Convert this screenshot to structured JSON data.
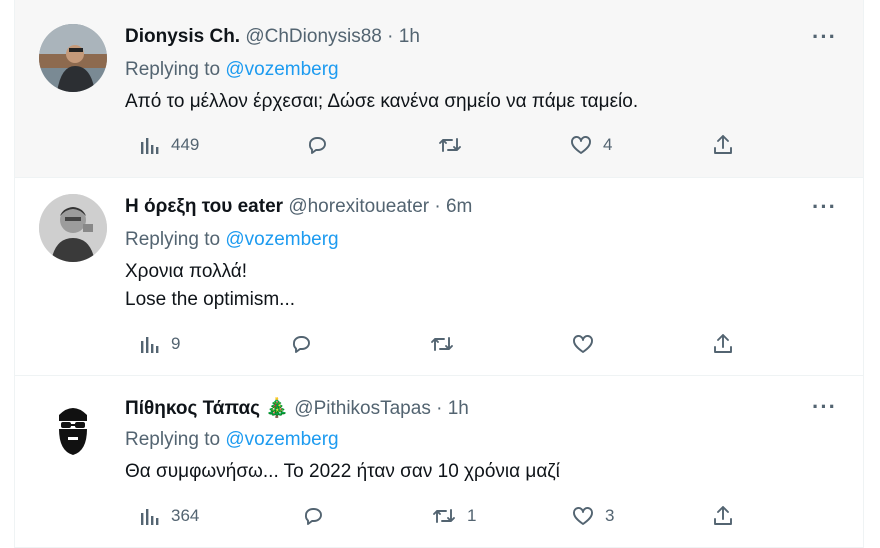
{
  "tweets": [
    {
      "name": "Dionysis Ch.",
      "handle": "@ChDionysis88",
      "dot": "·",
      "time": "1h",
      "replying_prefix": "Replying to",
      "replying_to": "@vozemberg",
      "text_lines": [
        "Από το μέλλον έρχεσαι; Δώσε κανένα σημείο να πάμε ταμείο."
      ],
      "views": "449",
      "replies": "",
      "retweets": "",
      "likes": "4",
      "more": "···"
    },
    {
      "name": "Η όρεξη του eater",
      "handle": "@horexitoueater",
      "dot": "·",
      "time": "6m",
      "replying_prefix": "Replying to",
      "replying_to": "@vozemberg",
      "text_lines": [
        "Χρονια πολλά!",
        "Lose the optimism..."
      ],
      "views": "9",
      "replies": "",
      "retweets": "",
      "likes": "",
      "more": "···"
    },
    {
      "name": "Πίθηκος Τάπας",
      "emoji": "🎄",
      "handle": "@PithikosTapas",
      "dot": "·",
      "time": "1h",
      "replying_prefix": "Replying to",
      "replying_to": "@vozemberg",
      "text_lines": [
        "Θα συμφωνήσω... Το 2022 ήταν σαν 10 χρόνια μαζί"
      ],
      "views": "364",
      "replies": "",
      "retweets": "1",
      "likes": "3",
      "more": "···"
    }
  ],
  "icons": {
    "views": "views-chart-icon",
    "reply": "reply-bubble-icon",
    "retweet": "retweet-icon",
    "like": "heart-icon",
    "share": "share-upload-icon",
    "more": "more-dots-icon"
  },
  "colors": {
    "link": "#1d9bf0",
    "secondary_text": "#536471",
    "primary_text": "#0f1419",
    "hover_bg": "#f7f7f7"
  }
}
